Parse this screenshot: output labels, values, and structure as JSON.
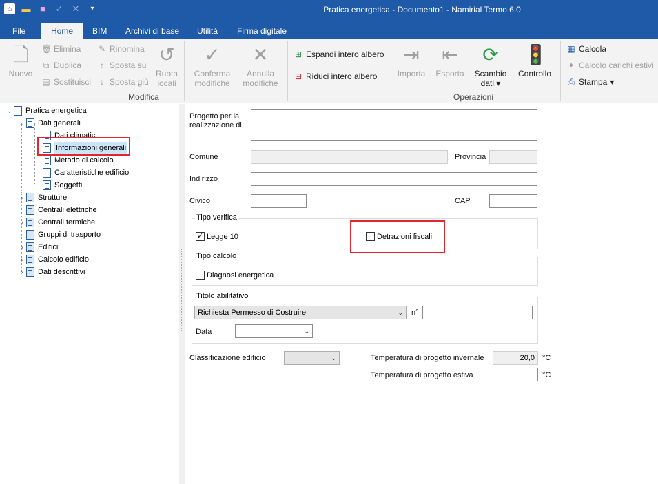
{
  "window": {
    "title": "Pratica energetica - Documento1 - Namirial Termo 6.0"
  },
  "qat": {
    "undo_icon": "undo-icon",
    "redo_icon": "redo-icon",
    "dropdown": "▾"
  },
  "tabs": [
    "File",
    "Home",
    "BIM",
    "Archivi di base",
    "Utilità",
    "Firma digitale"
  ],
  "ribbon": {
    "modifica": {
      "label": "Modifica",
      "nuovo": "Nuovo",
      "elimina": "Elimina",
      "duplica": "Duplica",
      "sostituisci": "Sostituisci",
      "rinomina": "Rinomina",
      "sposta_su": "Sposta su",
      "sposta_giu": "Sposta giù",
      "ruota": "Ruota",
      "locali": "locali",
      "conferma": "Conferma",
      "conferma2": "modifiche",
      "annulla": "Annulla",
      "annulla2": "modifiche",
      "espandi": "Espandi intero albero",
      "riduci": "Riduci intero albero"
    },
    "operazioni": {
      "label": "Operazioni",
      "importa": "Importa",
      "esporta": "Esporta",
      "scambio": "Scambio",
      "dati": "dati",
      "controllo": "Controllo",
      "calcola": "Calcola",
      "calcolo_carichi": "Calcolo carichi estivi",
      "stampa": "Stampa"
    }
  },
  "tree": {
    "root": "Pratica energetica",
    "dati_generali": "Dati generali",
    "dati_climatici": "Dati climatici",
    "informazioni_generali": "Informazioni generali",
    "metodo_calcolo": "Metodo di calcolo",
    "caratteristiche": "Caratteristiche edificio",
    "soggetti": "Soggetti",
    "strutture": "Strutture",
    "centrali_elettriche": "Centrali elettriche",
    "centrali_termiche": "Centrali termiche",
    "gruppi_trasporto": "Gruppi di trasporto",
    "edifici": "Edifici",
    "calcolo_edificio": "Calcolo edificio",
    "dati_descrittivi": "Dati descrittivi"
  },
  "form": {
    "progetto_label_1": "Progetto per la",
    "progetto_label_2": "realizzazione di",
    "progetto_value": "",
    "comune": "Comune",
    "provincia": "Provincia",
    "indirizzo": "Indirizzo",
    "civico": "Civico",
    "cap": "CAP",
    "tipo_verifica": "Tipo verifica",
    "legge10": "Legge 10",
    "legge10_checked": true,
    "detrazioni": "Detrazioni fiscali",
    "detrazioni_checked": false,
    "tipo_calcolo": "Tipo calcolo",
    "diagnosi": "Diagnosi energetica",
    "diagnosi_checked": false,
    "titolo_abilitativo": "Titolo abilitativo",
    "titolo_value": "Richiesta Permesso di Costruire",
    "numero_label": "n°",
    "data_label": "Data",
    "classificazione": "Classificazione edificio",
    "temp_invernale_label": "Temperatura di progetto invernale",
    "temp_invernale_value": "20,0",
    "temp_estiva_label": "Temperatura di progetto estiva",
    "temp_estiva_value": "",
    "unit_c": "°C"
  },
  "colors": {
    "accent": "#1e5aa8",
    "highlight": "#e0262f"
  }
}
